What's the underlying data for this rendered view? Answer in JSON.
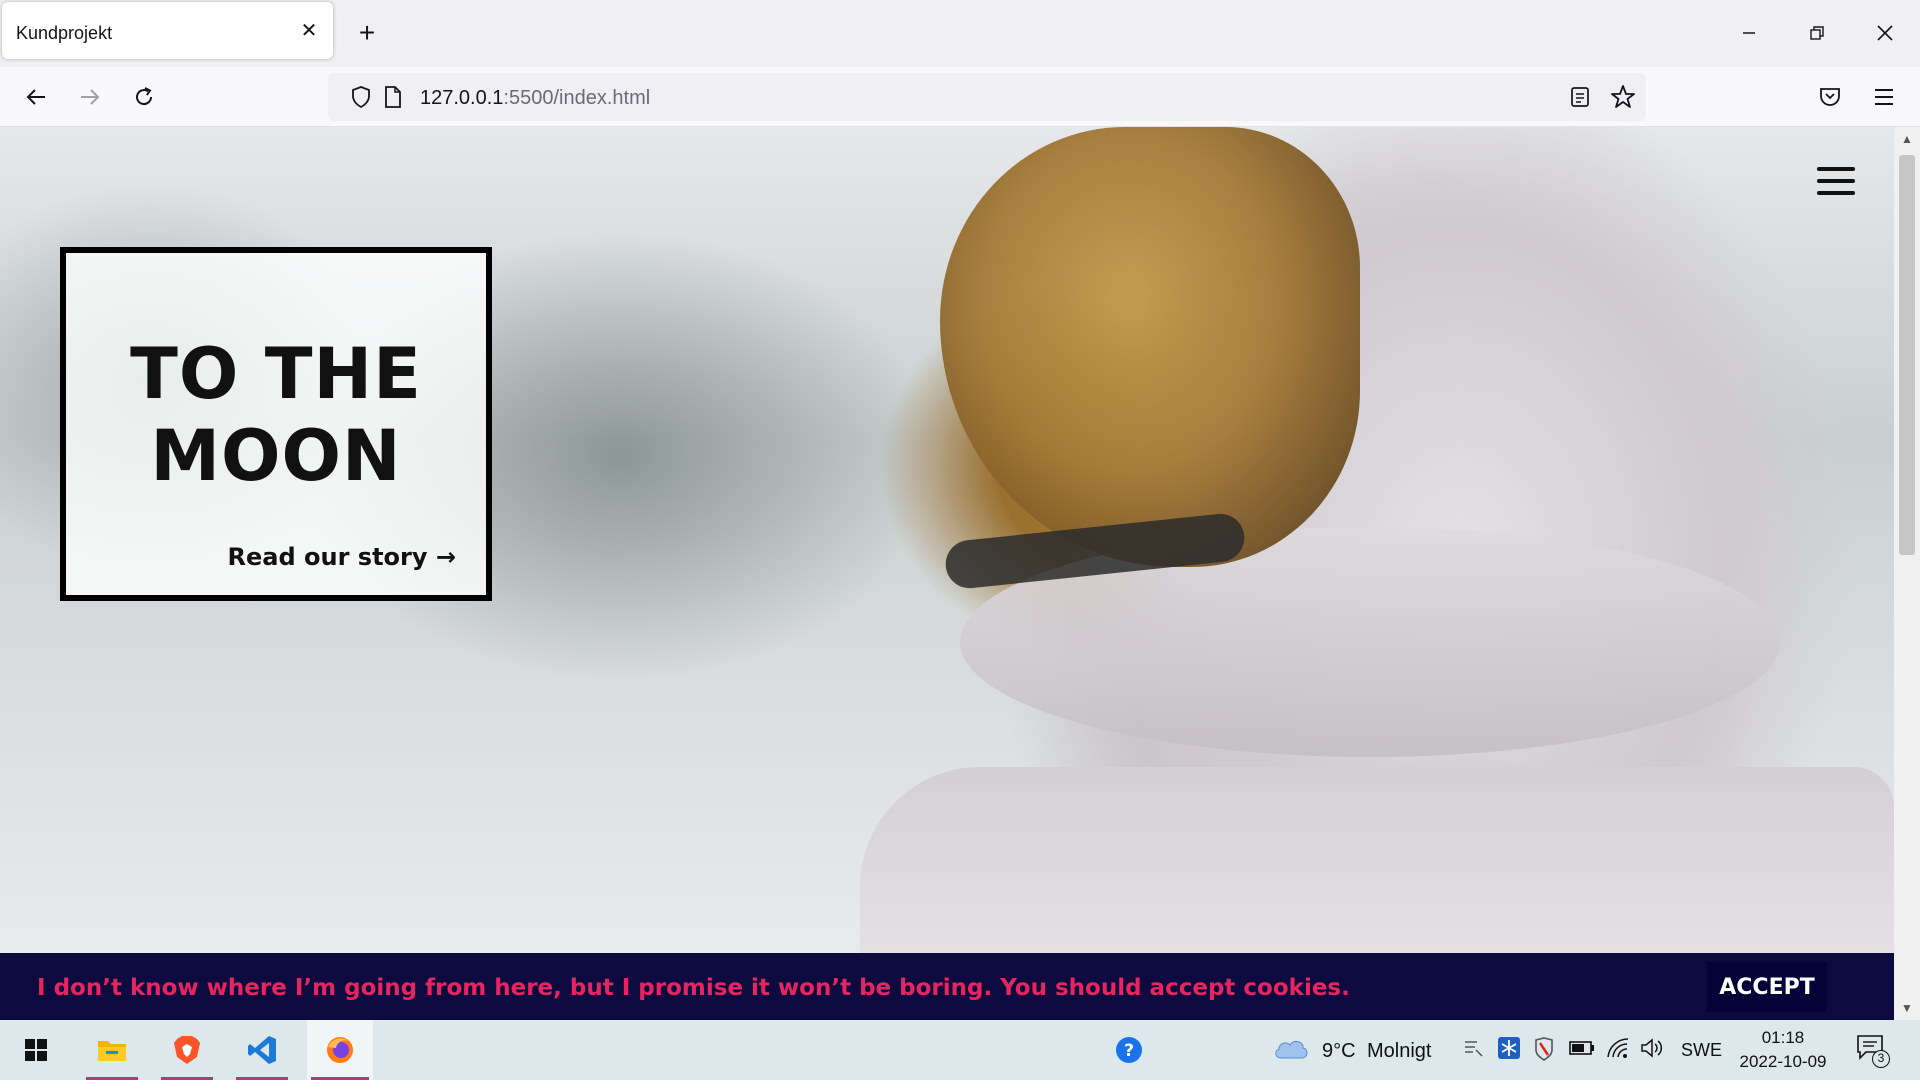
{
  "browser": {
    "tab_title": "Kundprojekt",
    "tab_close": "✕",
    "new_tab": "+",
    "url_host": "127.0.0.1",
    "url_rest": ":5500/index.html"
  },
  "page": {
    "hero": {
      "title_line1": "TO THE",
      "title_line2": "MOON",
      "link": "Read our story →"
    },
    "cookie_banner": {
      "text": "I don’t know where I’m going from here, but I promise it won’t be boring. You should accept cookies.",
      "button": "ACCEPT"
    }
  },
  "taskbar": {
    "weather_temp": "9°C",
    "weather_desc": "Molnigt",
    "language": "SWE",
    "time": "01:18",
    "date": "2022-10-09",
    "notifications": "3"
  },
  "colors": {
    "cookie_bg": "#0c0a3e",
    "cookie_text": "#e6245f",
    "accent": "#c3307b"
  }
}
